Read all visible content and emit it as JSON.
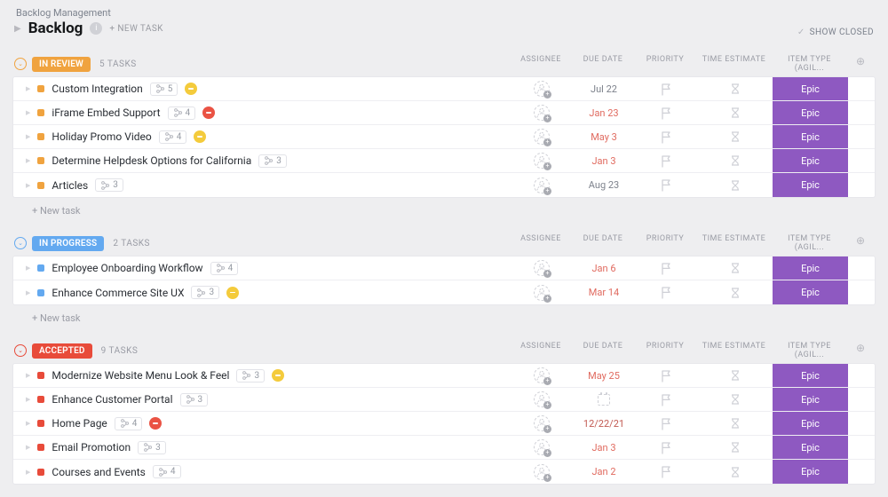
{
  "breadcrumb": "Backlog Management",
  "page_title": "Backlog",
  "new_task_label": "+ NEW TASK",
  "show_closed_label": "SHOW CLOSED",
  "columns": {
    "assignee": "ASSIGNEE",
    "due_date": "DUE DATE",
    "priority": "PRIORITY",
    "time_estimate": "TIME ESTIMATE",
    "item_type": "ITEM TYPE (AGIL..."
  },
  "new_task_row": "+ New task",
  "sections": [
    {
      "id": "in_review",
      "label": "IN REVIEW",
      "count_label": "5 TASKS",
      "color": "orange",
      "tasks": [
        {
          "name": "Custom Integration",
          "sub": "5",
          "dot": "yellow",
          "due": "Jul 22",
          "due_color": "",
          "type": "Epic"
        },
        {
          "name": "iFrame Embed Support",
          "sub": "4",
          "dot": "red",
          "due": "Jan 23",
          "due_color": "red",
          "type": "Epic"
        },
        {
          "name": "Holiday Promo Video",
          "sub": "4",
          "dot": "yellow",
          "due": "May 3",
          "due_color": "red",
          "type": "Epic"
        },
        {
          "name": "Determine Helpdesk Options for California",
          "sub": "3",
          "dot": "",
          "due": "Jan 3",
          "due_color": "red",
          "type": "Epic"
        },
        {
          "name": "Articles",
          "sub": "3",
          "dot": "",
          "due": "Aug 23",
          "due_color": "",
          "type": "Epic"
        }
      ]
    },
    {
      "id": "in_progress",
      "label": "IN PROGRESS",
      "count_label": "2 TASKS",
      "color": "blue",
      "tasks": [
        {
          "name": "Employee Onboarding Workflow",
          "sub": "4",
          "dot": "",
          "due": "Jan 6",
          "due_color": "red",
          "type": "Epic"
        },
        {
          "name": "Enhance Commerce Site UX",
          "sub": "3",
          "dot": "yellow",
          "due": "Mar 14",
          "due_color": "red",
          "type": "Epic"
        }
      ]
    },
    {
      "id": "accepted",
      "label": "ACCEPTED",
      "count_label": "9 TASKS",
      "color": "red",
      "tasks": [
        {
          "name": "Modernize Website Menu Look & Feel",
          "sub": "3",
          "dot": "yellow",
          "due": "May 25",
          "due_color": "red",
          "type": "Epic"
        },
        {
          "name": "Enhance Customer Portal",
          "sub": "3",
          "dot": "",
          "due": "CAL",
          "due_color": "",
          "type": "Epic"
        },
        {
          "name": "Home Page",
          "sub": "4",
          "dot": "red",
          "due": "12/22/21",
          "due_color": "maroon",
          "type": "Epic"
        },
        {
          "name": "Email Promotion",
          "sub": "3",
          "dot": "",
          "due": "Jan 3",
          "due_color": "red",
          "type": "Epic"
        },
        {
          "name": "Courses and Events",
          "sub": "4",
          "dot": "",
          "due": "Jan 2",
          "due_color": "red",
          "type": "Epic"
        }
      ]
    }
  ]
}
